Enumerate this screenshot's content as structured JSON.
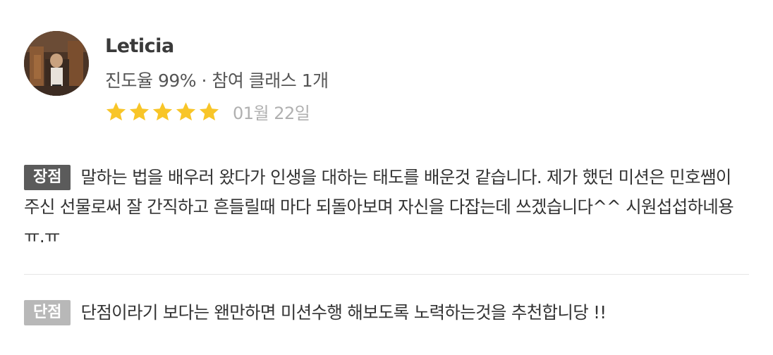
{
  "reviewer": {
    "name": "Leticia",
    "meta": "진도율 99% · 참여 클래스 1개"
  },
  "rating": {
    "stars": 5,
    "max_stars": 5,
    "star_color": "#f8c528",
    "date": "01월 22일"
  },
  "pros": {
    "label": "장점",
    "label_color": "#5b5b5b",
    "text": "말하는 법을 배우러 왔다가 인생을 대하는 태도를 배운것 같습니다. 제가 했던 미션은 민호쌤이 주신 선물로써 잘 간직하고 흔들릴때 마다 되돌아보며 자신을 다잡는데 쓰겠습니다^^ 시원섭섭하네용 ㅠ.ㅠ"
  },
  "cons": {
    "label": "단점",
    "label_color": "#b8b8b8",
    "text": "단점이라기 보다는 왠만하면 미션수행 해보도록 노력하는것을 추천합니당 !!"
  }
}
